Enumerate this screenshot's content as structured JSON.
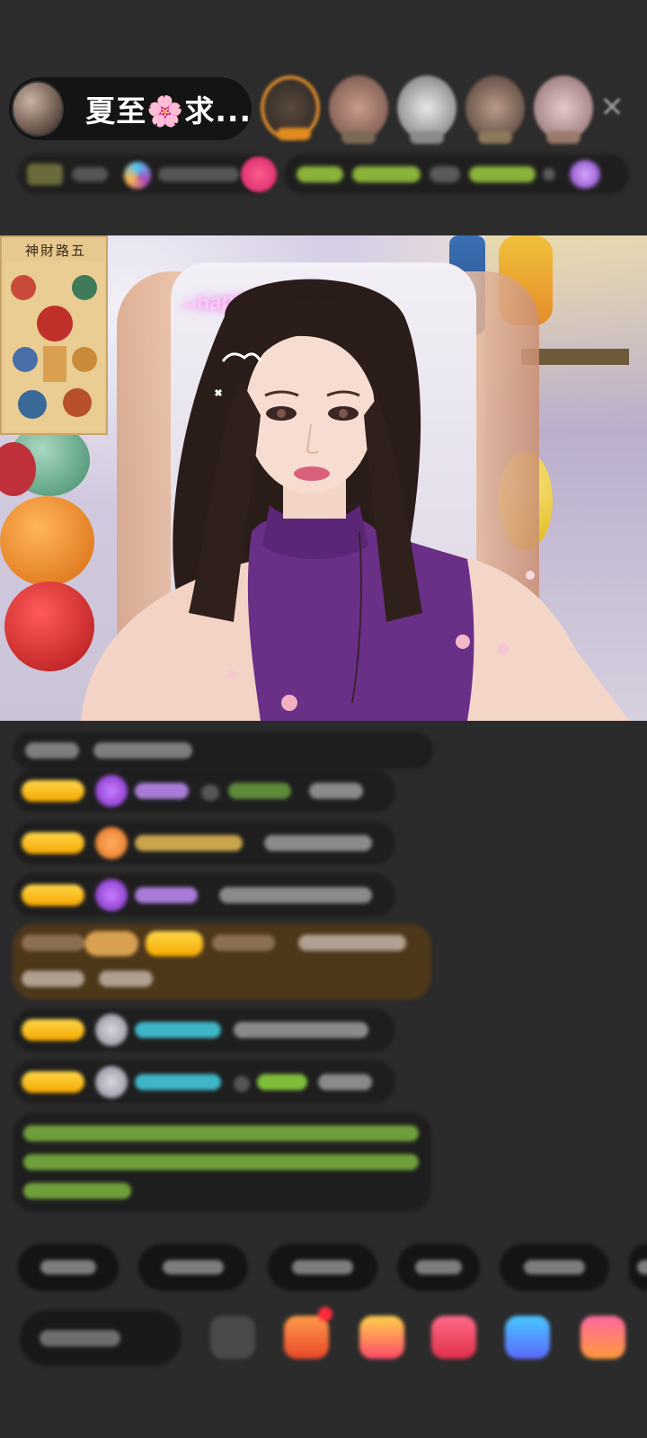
{
  "header": {
    "host_name": "夏至🌸求...",
    "close_glyph": "✕"
  },
  "video": {
    "poster_title": "神財路五",
    "neon_sign": "~happy~ ~ 6"
  },
  "colors": {
    "background": "#2b2b2b",
    "level_badge": "#f5b800",
    "chat_green": "#7fbf3a",
    "chat_cyan": "#3fb6c8",
    "chat_purple": "#a97bd8",
    "highlight_row": "#4a3410"
  },
  "icons": {
    "close": "close-icon",
    "gift": "gift-icon",
    "emoji": "emoji-icon",
    "diamond": "diamond-icon"
  }
}
